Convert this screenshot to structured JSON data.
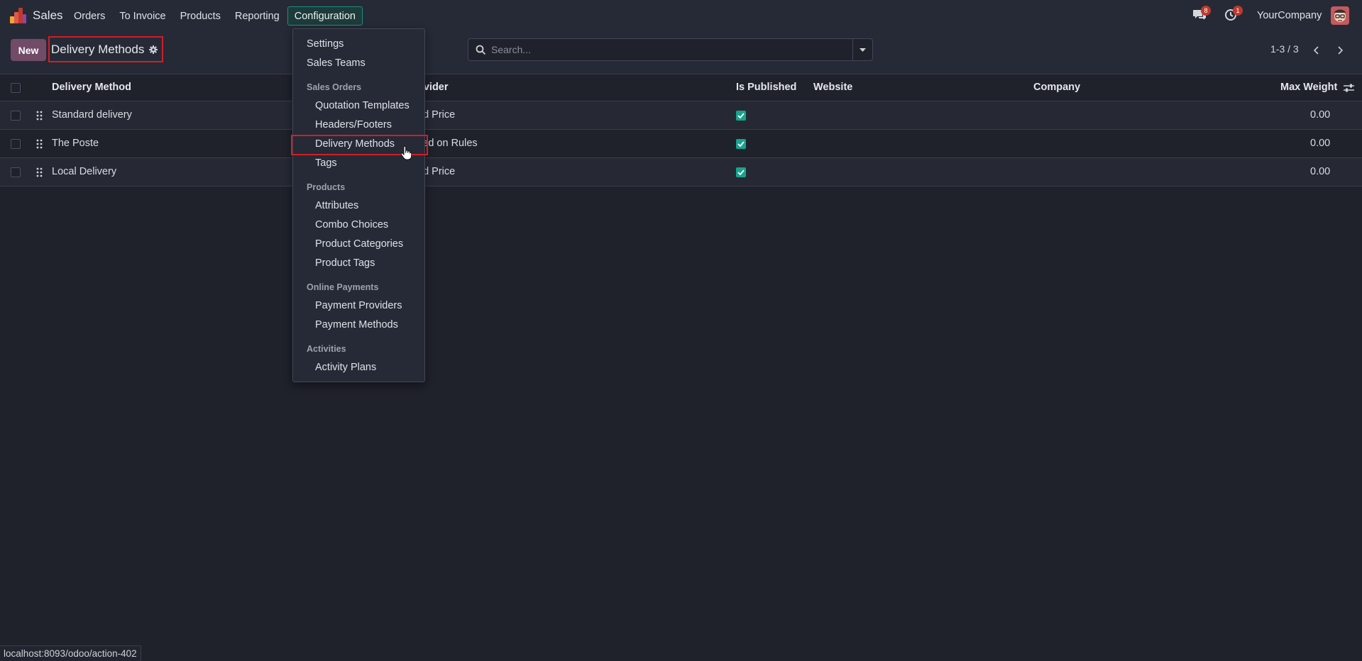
{
  "navbar": {
    "brand": "Sales",
    "menu": [
      "Orders",
      "To Invoice",
      "Products",
      "Reporting",
      "Configuration"
    ],
    "active_menu": "Configuration",
    "messages_badge": "8",
    "activities_badge": "1",
    "company": "YourCompany"
  },
  "control_panel": {
    "new_label": "New",
    "title": "Delivery Methods",
    "search_placeholder": "Search...",
    "pager": "1-3 / 3"
  },
  "table": {
    "columns": [
      "Delivery Method",
      "ovider",
      "Is Published",
      "Website",
      "Company",
      "Max Weight"
    ],
    "rows": [
      {
        "name": "Standard delivery",
        "provider": "ed Price",
        "published": true,
        "weight": "0.00"
      },
      {
        "name": "The Poste",
        "provider": "sed on Rules",
        "published": true,
        "weight": "0.00"
      },
      {
        "name": "Local Delivery",
        "provider": "ed Price",
        "published": true,
        "weight": "0.00"
      }
    ]
  },
  "dropdown": {
    "settings": "Settings",
    "sales_teams": "Sales Teams",
    "h_sales_orders": "Sales Orders",
    "quotation_templates": "Quotation Templates",
    "headers_footers": "Headers/Footers",
    "delivery_methods": "Delivery Methods",
    "tags": "Tags",
    "h_products": "Products",
    "attributes": "Attributes",
    "combo_choices": "Combo Choices",
    "product_categories": "Product Categories",
    "product_tags": "Product Tags",
    "h_online_payments": "Online Payments",
    "payment_providers": "Payment Providers",
    "payment_methods": "Payment Methods",
    "h_activities": "Activities",
    "activity_plans": "Activity Plans"
  },
  "statusbar": "localhost:8093/odoo/action-402",
  "colors": {
    "accent": "#714b67",
    "published": "#17a48e",
    "highlight": "#d01e28"
  }
}
